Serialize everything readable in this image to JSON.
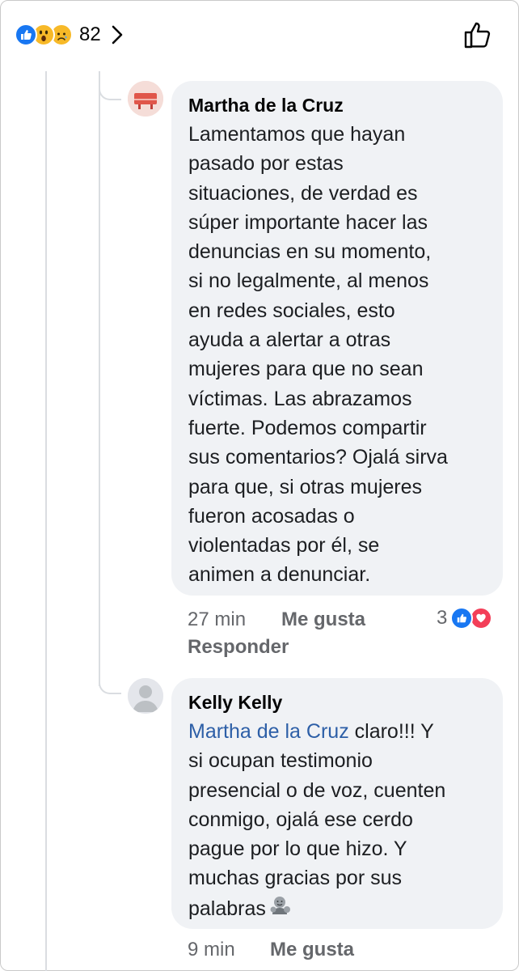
{
  "header": {
    "reaction_count": "82",
    "reaction_icons": [
      "like-reaction",
      "wow-reaction",
      "sad-reaction"
    ]
  },
  "comments": [
    {
      "author": "Martha de la Cruz",
      "text_lines": [
        "Lamentamos que hayan",
        "pasado por estas",
        "situaciones, de verdad es",
        "súper importante hacer las",
        "denuncias en su momento,",
        "si no legalmente, al menos",
        "en redes sociales, esto",
        "ayuda a alertar a otras",
        "mujeres para que no sean",
        "víctimas. Las abrazamos",
        "fuerte. Podemos compartir",
        "sus comentarios? Ojalá sirva",
        "para que, si otras mujeres",
        "fueron acosadas o",
        "violentadas por él, se",
        "animen a denunciar."
      ],
      "time": "27 min",
      "like_label": "Me gusta",
      "reply_label": "Responder",
      "reaction_count": "3"
    },
    {
      "author": "Kelly Kelly",
      "mention": "Martha de la Cruz",
      "first_line_rest": " claro!!! Y",
      "text_lines": [
        "si ocupan testimonio",
        "presencial o de voz, cuenten",
        "conmigo, ojalá ese cerdo",
        "pague por lo que hizo. Y",
        "muchas gracias por sus"
      ],
      "last_line": "palabras",
      "time": "9 min",
      "like_label": "Me gusta"
    }
  ],
  "colors": {
    "like_blue": "#1877f2",
    "love_red": "#f33e58",
    "bubble_bg": "#f0f2f5",
    "mention_blue": "#2d5fa7",
    "meta_gray": "#65676b"
  }
}
